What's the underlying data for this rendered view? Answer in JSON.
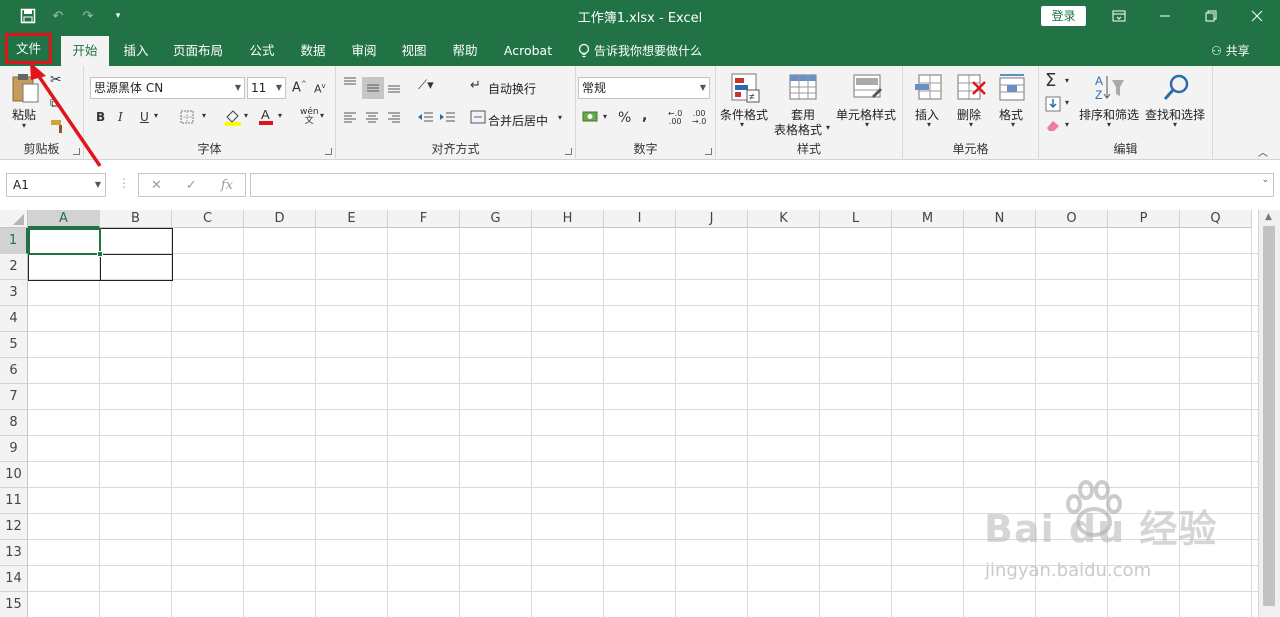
{
  "titlebar": {
    "title": "工作簿1.xlsx  -  Excel",
    "login": "登录",
    "qat": [
      "save-icon",
      "undo-icon",
      "redo-icon",
      "customize-icon"
    ],
    "window": [
      "ribbon-display-icon",
      "minimize-icon",
      "restore-icon",
      "close-icon"
    ]
  },
  "tabs": {
    "file": "文件",
    "home": "开始",
    "insert": "插入",
    "layout": "页面布局",
    "formulas": "公式",
    "data": "数据",
    "review": "审阅",
    "view": "视图",
    "help": "帮助",
    "acrobat": "Acrobat",
    "tell": "告诉我你想要做什么",
    "share": "共享"
  },
  "ribbon": {
    "clipboard": {
      "label": "剪贴板",
      "paste": "粘贴"
    },
    "font": {
      "label": "字体",
      "name": "思源黑体 CN",
      "size": "11",
      "bold": "B",
      "italic": "I",
      "underline": "U"
    },
    "align": {
      "label": "对齐方式",
      "wrap": "自动换行",
      "merge": "合并后居中"
    },
    "number": {
      "label": "数字",
      "format": "常规",
      "percent": "%",
      "comma": ","
    },
    "styles": {
      "label": "样式",
      "conditional": "条件格式",
      "table1": "套用",
      "table2": "表格格式",
      "cell": "单元格样式"
    },
    "cells": {
      "label": "单元格",
      "insert": "插入",
      "delete": "删除",
      "format": "格式"
    },
    "edit": {
      "label": "编辑",
      "sort": "排序和筛选",
      "find": "查找和选择"
    }
  },
  "formula": {
    "namebox": "A1",
    "fx": "fx"
  },
  "columns": [
    "A",
    "B",
    "C",
    "D",
    "E",
    "F",
    "G",
    "H",
    "I",
    "J",
    "K",
    "L",
    "M",
    "N",
    "O",
    "P",
    "Q"
  ],
  "rows": [
    "1",
    "2",
    "3",
    "4",
    "5",
    "6",
    "7",
    "8",
    "9",
    "10",
    "11",
    "12",
    "13",
    "14",
    "15"
  ],
  "watermark": {
    "main": "Bai du 经验",
    "sub": "jingyan.baidu.com"
  },
  "colors": {
    "accent": "#217346",
    "highlight": "#e3131b"
  }
}
